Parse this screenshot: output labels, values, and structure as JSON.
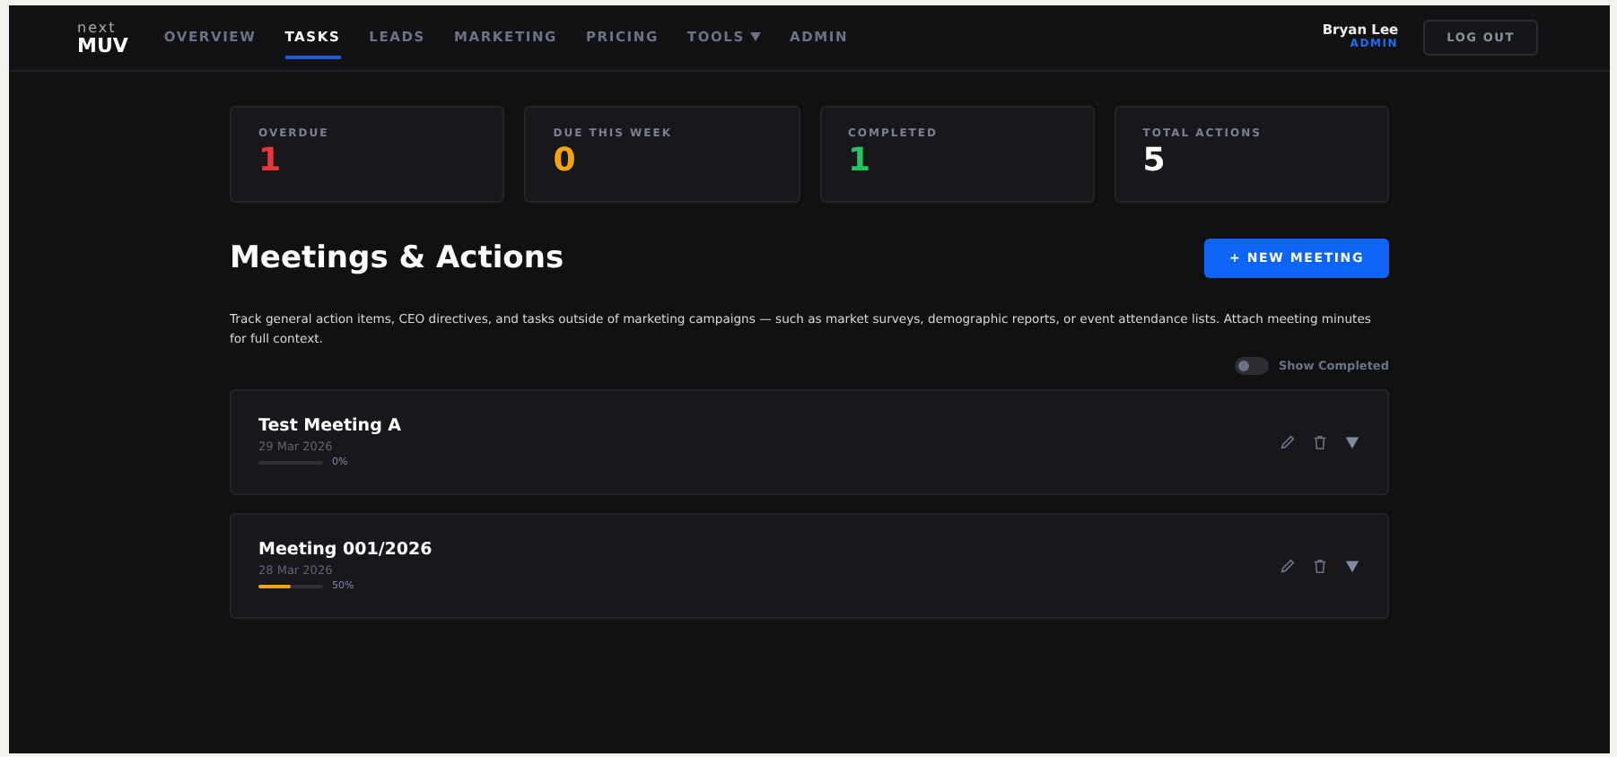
{
  "brand": {
    "top": "next",
    "bottom": "MUV"
  },
  "nav": [
    {
      "label": "OVERVIEW",
      "selected": false,
      "dropdown": false
    },
    {
      "label": "TASKS",
      "selected": true,
      "dropdown": false
    },
    {
      "label": "LEADS",
      "selected": false,
      "dropdown": false
    },
    {
      "label": "MARKETING",
      "selected": false,
      "dropdown": false
    },
    {
      "label": "PRICING",
      "selected": false,
      "dropdown": false
    },
    {
      "label": "TOOLS",
      "selected": false,
      "dropdown": true
    },
    {
      "label": "ADMIN",
      "selected": false,
      "dropdown": false
    }
  ],
  "user": {
    "name": "Bryan Lee",
    "role": "ADMIN"
  },
  "logout": "LOG OUT",
  "stats": [
    {
      "label": "OVERDUE",
      "value": "1",
      "color": "#e5383b"
    },
    {
      "label": "DUE THIS WEEK",
      "value": "0",
      "color": "#f5a50b"
    },
    {
      "label": "COMPLETED",
      "value": "1",
      "color": "#22c55e"
    },
    {
      "label": "TOTAL ACTIONS",
      "value": "5",
      "color": "#ffffff"
    }
  ],
  "title": "Meetings & Actions",
  "new_button": "+ NEW MEETING",
  "description": "Track general action items, CEO directives, and tasks outside of marketing campaigns — such as market surveys, demographic reports, or event attendance lists. Attach meeting minutes for full context.",
  "show_completed": {
    "label": "Show Completed",
    "on": false
  },
  "meetings": [
    {
      "title": "Test Meeting A",
      "date": "29 Mar 2026",
      "level": 0,
      "reading": "0%"
    },
    {
      "title": "Meeting 001/2026",
      "date": "28 Mar 2026",
      "level": 0.5,
      "reading": "50%"
    }
  ]
}
